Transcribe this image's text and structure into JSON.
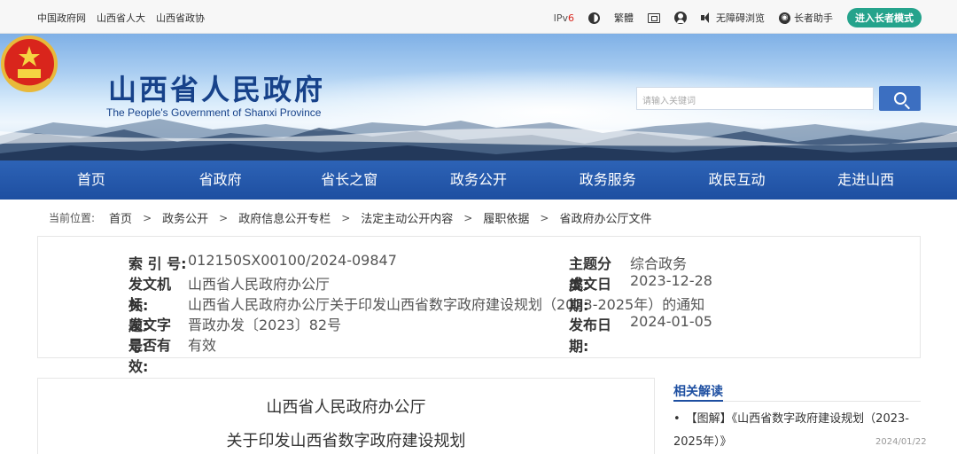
{
  "topbar": {
    "links": [
      "中国政府网",
      "山西省人大",
      "山西省政协"
    ],
    "ipv6": "IPv6",
    "traditional": "繁體",
    "accessibility": "无障碍浏览",
    "elder_helper": "长者助手",
    "elder_mode": "进入长者模式"
  },
  "header": {
    "title": "山西省人民政府",
    "subtitle": "The People's Government of Shanxi Province",
    "search_placeholder": "请输入关键词"
  },
  "nav": [
    "首页",
    "省政府",
    "省长之窗",
    "政务公开",
    "政务服务",
    "政民互动",
    "走进山西"
  ],
  "breadcrumb": {
    "label": "当前位置:",
    "items": [
      "首页",
      "政务公开",
      "政府信息公开专栏",
      "法定主动公开内容",
      "履职依据",
      "省政府办公厅文件"
    ]
  },
  "info": {
    "index_key": "索 引 号:",
    "index_val": "012150SX00100/2024-09847",
    "org_key": "发文机关:",
    "org_val": "山西省人民政府办公厅",
    "title_key": "标　　题:",
    "title_val": "山西省人民政府办公厅关于印发山西省数字政府建设规划（2023-2025年）的通知",
    "num_key": "发文字号:",
    "num_val": "晋政办发〔2023〕82号",
    "valid_key": "是否有效:",
    "valid_val": "有效",
    "topic_key": "主题分类:",
    "topic_val": "综合政务",
    "date_key": "成文日期:",
    "date_val": "2023-12-28",
    "pub_key": "发布日期:",
    "pub_val": "2024-01-05"
  },
  "doc": {
    "title_line1": "山西省人民政府办公厅",
    "title_line2": "关于印发山西省数字政府建设规划"
  },
  "related": {
    "heading": "相关解读",
    "item1": "【图解】《山西省数字政府建设规划（2023-2025年）》",
    "item1_date": "2024/01/22"
  }
}
